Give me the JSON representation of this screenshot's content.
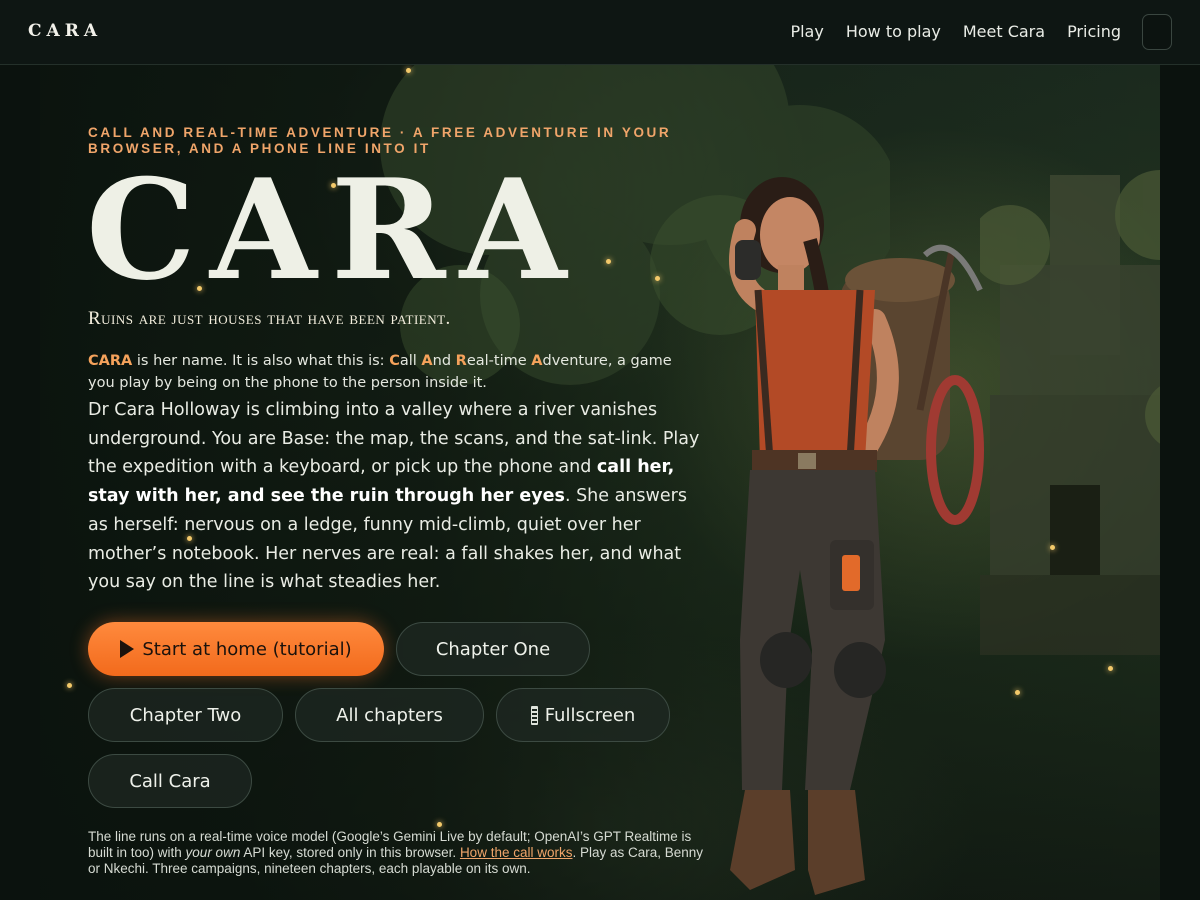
{
  "nav": {
    "brand": "CARA",
    "links": [
      "Play",
      "How to play",
      "Meet Cara",
      "Pricing"
    ]
  },
  "hero": {
    "eyebrow": "CALL AND REAL-TIME ADVENTURE · A FREE ADVENTURE IN YOUR BROWSER, AND A PHONE LINE INTO IT",
    "title": "CARA",
    "tagline": "Ruins are just houses that have been patient.",
    "intro": {
      "name": "CARA",
      "text1": " is her name. It is also what this is: ",
      "c": "C",
      "all": "all ",
      "a1": "A",
      "nd": "nd ",
      "r": "R",
      "eal": "eal-time ",
      "a2": "A",
      "dv": "dventure, a game you play by being on the phone to the person inside it."
    },
    "body": {
      "p1": "Dr Cara Holloway is climbing into a valley where a river vanishes underground. You are Base: the map, the scans, and the sat-link. Play the expedition with a keyboard, or pick up the phone and ",
      "strong": "call her, stay with her, and see the ruin through her eyes",
      "p2": ". She answers as herself: nervous on a ledge, funny mid-climb, quiet over her mother’s notebook. Her nerves are real: a fall shakes her, and what you say on the line is what steadies her."
    },
    "buttons": {
      "start": "Start at home (tutorial)",
      "chapter_one": "Chapter One",
      "chapter_two": "Chapter Two",
      "all_chapters": "All chapters",
      "fullscreen": "Fullscreen",
      "call": "Call Cara"
    },
    "fineprint": {
      "t1": "The line runs on a real-time voice model (Google’s Gemini Live by default; OpenAI’s GPT Realtime is built in too) with ",
      "em": "your own",
      "t2": " API key, stored only in this browser. ",
      "link": "How the call works",
      "t3": ". Play as Cara, Benny or Nkechi. Three campaigns, nineteen chapters, each playable on its own."
    }
  },
  "colors": {
    "accent": "#f26a1c",
    "eyebrow": "#f0a56a",
    "background": "#0d1511"
  },
  "icons": [
    "play-icon",
    "fullscreen-icon"
  ]
}
